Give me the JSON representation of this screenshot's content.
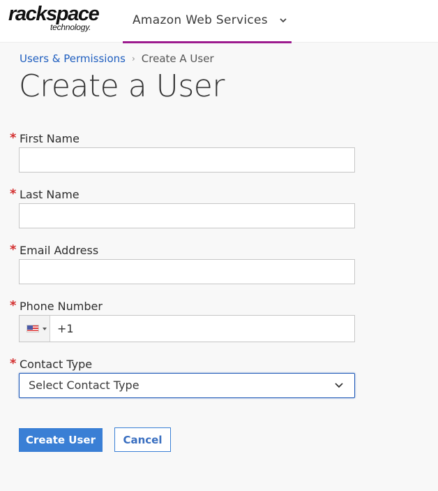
{
  "header": {
    "logo_main": "rackspace",
    "logo_sub": "technology.",
    "account_label": "Amazon Web Services",
    "accent_color": "#9c1a8e"
  },
  "breadcrumb": {
    "items": [
      {
        "label": "Users & Permissions",
        "link": true
      },
      {
        "label": "Create A User",
        "link": false
      }
    ],
    "separator": "›"
  },
  "page": {
    "title": "Create a User"
  },
  "form": {
    "required_marker": "*",
    "fields": [
      {
        "label": "First Name",
        "value": "",
        "placeholder": ""
      },
      {
        "label": "Last Name",
        "value": "",
        "placeholder": ""
      },
      {
        "label": "Email Address",
        "value": "",
        "placeholder": ""
      },
      {
        "label": "Phone Number",
        "value": "+1",
        "country": "US",
        "country_icon": "us-flag-icon"
      },
      {
        "label": "Contact Type",
        "selected": "Select Contact Type"
      }
    ],
    "submit_label": "Create User",
    "cancel_label": "Cancel"
  },
  "colors": {
    "primary": "#3a7fd5",
    "link": "#1f5ebf",
    "required": "#d32f2f"
  }
}
